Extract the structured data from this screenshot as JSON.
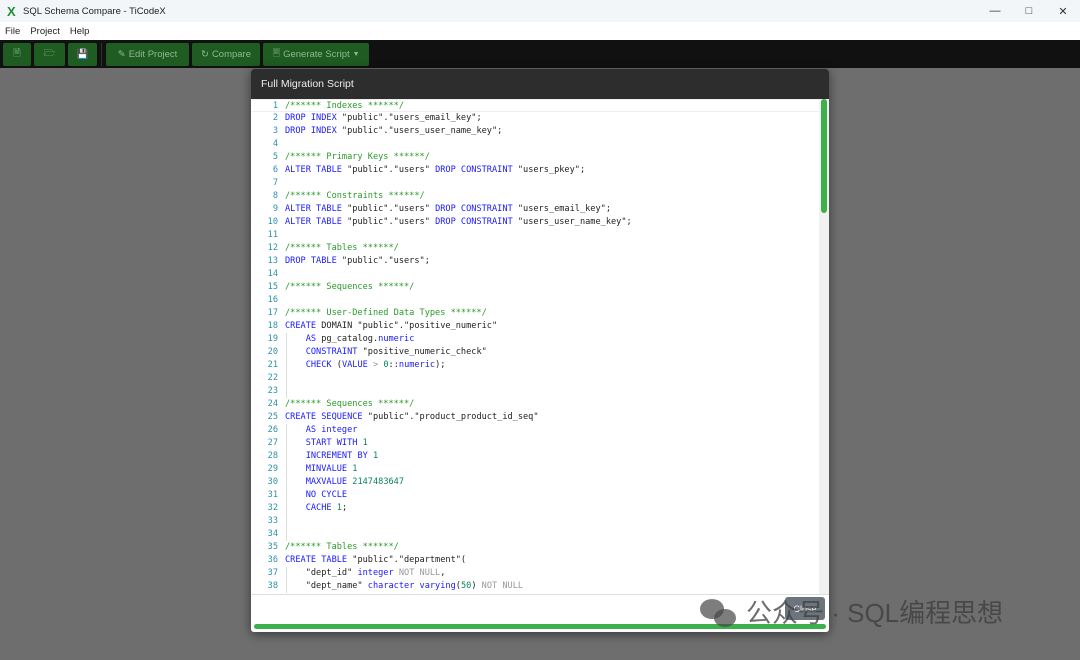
{
  "window": {
    "title": "SQL Schema Compare - TiCodeX",
    "app_icon": "x-logo-icon"
  },
  "menu": [
    "File",
    "Project",
    "Help"
  ],
  "toolbar": {
    "edit_project": "Edit Project",
    "compare": "Compare",
    "generate_script": "Generate Script"
  },
  "modal": {
    "title": "Full Migration Script",
    "close_label": "Close",
    "progress_percent": 100
  },
  "watermark": "公众号 · SQL编程思想",
  "colors": {
    "accent": "#3cb04a",
    "toolbar_button": "#1e5c21",
    "keyword": "#1a1aff",
    "comment": "#2a9a2a"
  },
  "code_lines": [
    [
      [
        "c",
        "/****** Indexes ******/"
      ]
    ],
    [
      [
        "k",
        "DROP INDEX "
      ],
      [
        "t",
        "\"public\".\"users_email_key\";"
      ]
    ],
    [
      [
        "k",
        "DROP INDEX "
      ],
      [
        "t",
        "\"public\".\"users_user_name_key\";"
      ]
    ],
    [],
    [
      [
        "c",
        "/****** Primary Keys ******/"
      ]
    ],
    [
      [
        "k",
        "ALTER TABLE "
      ],
      [
        "t",
        "\"public\".\"users\" "
      ],
      [
        "k",
        "DROP CONSTRAINT "
      ],
      [
        "t",
        "\"users_pkey\";"
      ]
    ],
    [],
    [
      [
        "c",
        "/****** Constraints ******/"
      ]
    ],
    [
      [
        "k",
        "ALTER TABLE "
      ],
      [
        "t",
        "\"public\".\"users\" "
      ],
      [
        "k",
        "DROP CONSTRAINT "
      ],
      [
        "t",
        "\"users_email_key\";"
      ]
    ],
    [
      [
        "k",
        "ALTER TABLE "
      ],
      [
        "t",
        "\"public\".\"users\" "
      ],
      [
        "k",
        "DROP CONSTRAINT "
      ],
      [
        "t",
        "\"users_user_name_key\";"
      ]
    ],
    [],
    [
      [
        "c",
        "/****** Tables ******/"
      ]
    ],
    [
      [
        "k",
        "DROP TABLE "
      ],
      [
        "t",
        "\"public\".\"users\";"
      ]
    ],
    [],
    [
      [
        "c",
        "/****** Sequences ******/"
      ]
    ],
    [],
    [
      [
        "c",
        "/****** User-Defined Data Types ******/"
      ]
    ],
    [
      [
        "k",
        "CREATE "
      ],
      [
        "t",
        "DOMAIN \"public\".\"positive_numeric\""
      ]
    ],
    [
      [
        "t",
        "    "
      ],
      [
        "k",
        "AS "
      ],
      [
        "t",
        "pg_catalog."
      ],
      [
        "k",
        "numeric"
      ]
    ],
    [
      [
        "t",
        "    "
      ],
      [
        "k",
        "CONSTRAINT "
      ],
      [
        "t",
        "\"positive_numeric_check\""
      ]
    ],
    [
      [
        "t",
        "    "
      ],
      [
        "k",
        "CHECK "
      ],
      [
        "t",
        "("
      ],
      [
        "k",
        "VALUE "
      ],
      [
        "g",
        "> "
      ],
      [
        "n",
        "0"
      ],
      [
        "t",
        "::"
      ],
      [
        "k",
        "numeric"
      ],
      [
        "t",
        ");"
      ]
    ],
    [
      [
        "t",
        "    "
      ]
    ],
    [
      [
        "t",
        "    "
      ]
    ],
    [
      [
        "c",
        "/****** Sequences ******/"
      ]
    ],
    [
      [
        "k",
        "CREATE SEQUENCE "
      ],
      [
        "t",
        "\"public\".\"product_product_id_seq\""
      ]
    ],
    [
      [
        "t",
        "    "
      ],
      [
        "k",
        "AS integer"
      ]
    ],
    [
      [
        "t",
        "    "
      ],
      [
        "k",
        "START WITH "
      ],
      [
        "n",
        "1"
      ]
    ],
    [
      [
        "t",
        "    "
      ],
      [
        "k",
        "INCREMENT BY "
      ],
      [
        "n",
        "1"
      ]
    ],
    [
      [
        "t",
        "    "
      ],
      [
        "k",
        "MINVALUE "
      ],
      [
        "n",
        "1"
      ]
    ],
    [
      [
        "t",
        "    "
      ],
      [
        "k",
        "MAXVALUE "
      ],
      [
        "n",
        "2147483647"
      ]
    ],
    [
      [
        "t",
        "    "
      ],
      [
        "k",
        "NO CYCLE"
      ]
    ],
    [
      [
        "t",
        "    "
      ],
      [
        "k",
        "CACHE "
      ],
      [
        "n",
        "1"
      ],
      [
        "t",
        ";"
      ]
    ],
    [
      [
        "t",
        "    "
      ]
    ],
    [
      [
        "t",
        "    "
      ]
    ],
    [
      [
        "c",
        "/****** Tables ******/"
      ]
    ],
    [
      [
        "k",
        "CREATE TABLE "
      ],
      [
        "t",
        "\"public\".\"department\"("
      ]
    ],
    [
      [
        "t",
        "    \"dept_id\" "
      ],
      [
        "k",
        "integer "
      ],
      [
        "g",
        "NOT NULL"
      ],
      [
        "t",
        ","
      ]
    ],
    [
      [
        "t",
        "    \"dept_name\" "
      ],
      [
        "k",
        "character varying"
      ],
      [
        "t",
        "("
      ],
      [
        "n",
        "50"
      ],
      [
        "t",
        ") "
      ],
      [
        "g",
        "NOT NULL"
      ]
    ]
  ]
}
